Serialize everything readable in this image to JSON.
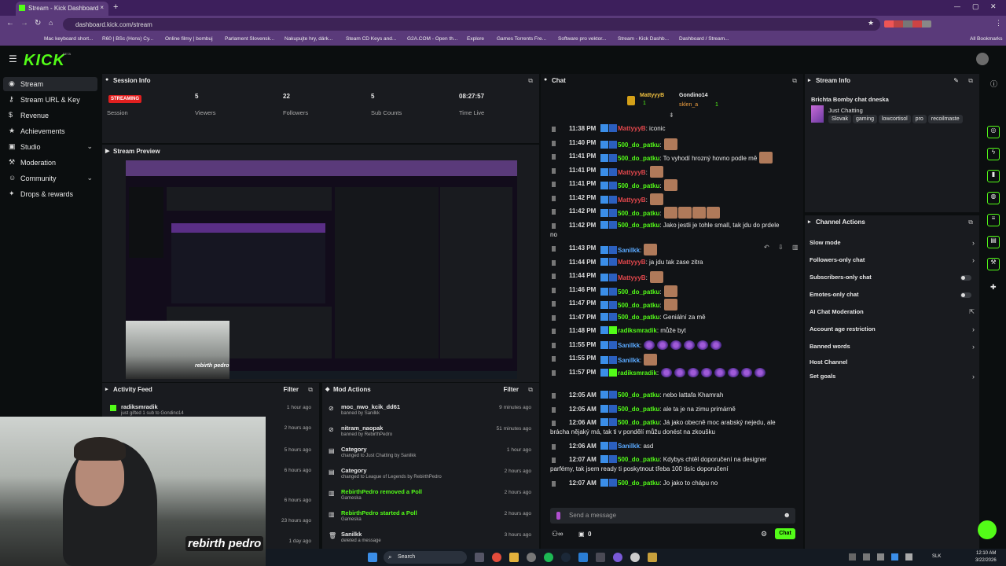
{
  "browser": {
    "tab_title": "Stream - Kick Dashboard",
    "new_tab": "+",
    "url": "dashboard.kick.com/stream",
    "window_controls": [
      "—",
      "▢",
      "✕"
    ],
    "bookmarks": [
      "Mac keyboard short...",
      "R60 | BSc (Hons) Cy...",
      "Online filmy | bombuj",
      "Parlament Slovensk...",
      "Nakupujte hry, dárk...",
      "Steam CD Keys and...",
      "G2A.COM - Open th...",
      "Explore",
      "Games Torrents Fre...",
      "Software pro vektor...",
      "Stream - Kick Dashb...",
      "Dashboard / Stream..."
    ],
    "all_bookmarks": "All Bookmarks"
  },
  "header": {
    "logo": "KICK",
    "logo_sup": "BETA"
  },
  "sidebar": {
    "items": [
      {
        "label": "Stream",
        "icon": "stream-icon",
        "glyph": "◉"
      },
      {
        "label": "Stream URL & Key",
        "icon": "key-icon",
        "glyph": "⚷"
      },
      {
        "label": "Revenue",
        "icon": "revenue-icon",
        "glyph": "$"
      },
      {
        "label": "Achievements",
        "icon": "achievements-icon",
        "glyph": "★"
      },
      {
        "label": "Studio",
        "icon": "studio-icon",
        "glyph": "▣"
      },
      {
        "label": "Moderation",
        "icon": "moderation-icon",
        "glyph": "⚒"
      },
      {
        "label": "Community",
        "icon": "community-icon",
        "glyph": "☺"
      },
      {
        "label": "Drops & rewards",
        "icon": "drops-icon",
        "glyph": "✦"
      }
    ]
  },
  "session": {
    "title": "Session Info",
    "status": "STREAMING",
    "session_label": "Session",
    "stats": [
      {
        "value": "5",
        "label": "Viewers"
      },
      {
        "value": "22",
        "label": "Followers"
      },
      {
        "value": "5",
        "label": "Sub Counts"
      },
      {
        "value": "08:27:57",
        "label": "Time Live"
      }
    ]
  },
  "preview": {
    "title": "Stream Preview",
    "overlay": "rebirth pedro"
  },
  "activity": {
    "title": "Activity Feed",
    "filter": "Filter",
    "rows": [
      {
        "title": "radiksmradik",
        "sub": "just gifted 1 sub to Gondino14",
        "time": "1 hour ago"
      },
      {
        "title": "",
        "sub": "",
        "time": "2 hours ago"
      },
      {
        "title": "",
        "sub": "",
        "time": "5 hours ago"
      },
      {
        "title": "",
        "sub": "",
        "time": "6 hours ago"
      },
      {
        "title": "",
        "sub": "",
        "time": "6 hours ago"
      },
      {
        "title": "",
        "sub": "",
        "time": "23 hours ago"
      },
      {
        "title": "",
        "sub": "",
        "time": "1 day ago"
      }
    ]
  },
  "mod": {
    "title": "Mod Actions",
    "filter": "Filter",
    "rows": [
      {
        "title": "moc_nwo_kcik_dd61",
        "sub": "banned by Sanilkk",
        "time": "9 minutes ago"
      },
      {
        "title": "nitram_naopak",
        "sub": "banned by RebirthPedro",
        "time": "51 minutes ago"
      },
      {
        "title": "Category",
        "sub": "changed to Just Chatting by Sanilkk",
        "time": "1 hour ago"
      },
      {
        "title": "Category",
        "sub": "changed to League of Legends by RebirthPedro",
        "time": "2 hours ago"
      },
      {
        "title": "RebirthPedro removed a Poll",
        "sub": "Gameska",
        "time": "2 hours ago"
      },
      {
        "title": "RebirthPedro started a Poll",
        "sub": "Gameska",
        "time": "2 hours ago"
      },
      {
        "title": "Sanilkk",
        "sub": "deleted a message",
        "time": "3 hours ago"
      }
    ]
  },
  "chat": {
    "title": "Chat",
    "top_gifters": [
      {
        "name": "MattyyyB",
        "count": "1"
      },
      {
        "name": "Gondino14",
        "count": "1"
      },
      {
        "name": "sklen_a",
        "count": "1"
      }
    ],
    "messages": [
      {
        "time": "11:38 PM",
        "user": "MattyyyB",
        "color": "#e5484d",
        "text": ": iconic",
        "emotes": 0
      },
      {
        "time": "11:40 PM",
        "user": "500_do_patku",
        "color": "#53fc18",
        "text": ":",
        "emotes": 1
      },
      {
        "time": "11:41 PM",
        "user": "500_do_patku",
        "color": "#53fc18",
        "text": ": To vyhodí hrozný hovno podle mě",
        "emotes": 1
      },
      {
        "time": "11:41 PM",
        "user": "MattyyyB",
        "color": "#e5484d",
        "text": ":",
        "emotes": 1
      },
      {
        "time": "11:41 PM",
        "user": "500_do_patku",
        "color": "#53fc18",
        "text": ":",
        "emotes": 1
      },
      {
        "time": "11:42 PM",
        "user": "MattyyyB",
        "color": "#e5484d",
        "text": ":",
        "emotes": 1
      },
      {
        "time": "11:42 PM",
        "user": "500_do_patku",
        "color": "#53fc18",
        "text": ":",
        "emotes": 4
      },
      {
        "time": "11:42 PM",
        "user": "500_do_patku",
        "color": "#53fc18",
        "text": ": Jako jestli je tohle small, tak jdu do prdele",
        "cont": "no",
        "emotes": 0
      },
      {
        "time": "11:43 PM",
        "user": "Sanilkk",
        "color": "#5aa9ff",
        "text": ":",
        "emotes": 1
      },
      {
        "time": "11:44 PM",
        "user": "MattyyyB",
        "color": "#e5484d",
        "text": ": ja jdu tak zase zitra",
        "emotes": 0
      },
      {
        "time": "11:44 PM",
        "user": "MattyyyB",
        "color": "#e5484d",
        "text": ":",
        "emotes": 1
      },
      {
        "time": "11:46 PM",
        "user": "500_do_patku",
        "color": "#53fc18",
        "text": ":",
        "emotes": 1
      },
      {
        "time": "11:47 PM",
        "user": "500_do_patku",
        "color": "#53fc18",
        "text": ":",
        "emotes": 1
      },
      {
        "time": "11:47 PM",
        "user": "500_do_patku",
        "color": "#53fc18",
        "text": ": Geniální za mě",
        "emotes": 0
      },
      {
        "time": "11:48 PM",
        "user": "radiksmradik",
        "color": "#53fc18",
        "text": ": může byt",
        "emotes": 0
      },
      {
        "time": "11:55 PM",
        "user": "Sanilkk",
        "color": "#5aa9ff",
        "text": ":",
        "balls": 6
      },
      {
        "time": "11:55 PM",
        "user": "Sanilkk",
        "color": "#5aa9ff",
        "text": ":",
        "emotes": 1
      },
      {
        "time": "11:57 PM",
        "user": "radiksmradik",
        "color": "#53fc18",
        "text": ":",
        "balls": 8
      },
      {
        "time": "12:05 AM",
        "user": "500_do_patku",
        "color": "#53fc18",
        "text": ": nebo lattafa Khamrah",
        "emotes": 0
      },
      {
        "time": "12:05 AM",
        "user": "500_do_patku",
        "color": "#53fc18",
        "text": ": ale ta je na zimu primárně",
        "emotes": 0
      },
      {
        "time": "12:06 AM",
        "user": "500_do_patku",
        "color": "#53fc18",
        "text": ": Já jako obecně moc arabský nejedu, ale",
        "cont": "brácha nějaký má, tak ti v pondělí můžu donést na zkoušku",
        "emotes": 0
      },
      {
        "time": "12:06 AM",
        "user": "Sanilkk",
        "color": "#5aa9ff",
        "text": ": asd",
        "emotes": 0
      },
      {
        "time": "12:07 AM",
        "user": "500_do_patku",
        "color": "#53fc18",
        "text": ": Kdybys chtěl doporučení na designer",
        "cont": "parfémy, tak jsem ready ti poskytnout třeba 100 tisíc doporučení",
        "emotes": 0
      },
      {
        "time": "12:07 AM",
        "user": "500_do_patku",
        "color": "#53fc18",
        "text": ": Jo jako to chápu no",
        "emotes": 0
      }
    ],
    "input_placeholder": "Send a message",
    "count": "0",
    "send": "Chat"
  },
  "stream_info": {
    "title": "Stream Info",
    "stream_title": "Brichta Bomby chat dneska",
    "category": "Just Chatting",
    "tags": [
      "Slovak",
      "gaming",
      "lowcortisol",
      "pro",
      "recoilmaste"
    ]
  },
  "channel_actions": {
    "title": "Channel Actions",
    "items": [
      {
        "label": "Slow mode",
        "kind": "chevron"
      },
      {
        "label": "Followers-only chat",
        "kind": "chevron"
      },
      {
        "label": "Subscribers-only chat",
        "kind": "toggle"
      },
      {
        "label": "Emotes-only chat",
        "kind": "toggle"
      },
      {
        "label": "AI Chat Moderation",
        "kind": "external"
      },
      {
        "label": "Account age restriction",
        "kind": "chevron"
      },
      {
        "label": "Banned words",
        "kind": "chevron"
      },
      {
        "label": "Host Channel",
        "kind": "none"
      },
      {
        "label": "Set goals",
        "kind": "chevron"
      }
    ]
  },
  "webcam": {
    "overlay": "rebirth pedro"
  },
  "taskbar": {
    "search": "Search",
    "lang": "SLK",
    "time": "12:10 AM",
    "date": "3/22/2026"
  },
  "colors": {
    "accent": "#53fc18",
    "panel": "#191b1f",
    "bg": "#0b0e0f",
    "live": "#e01f1f"
  }
}
